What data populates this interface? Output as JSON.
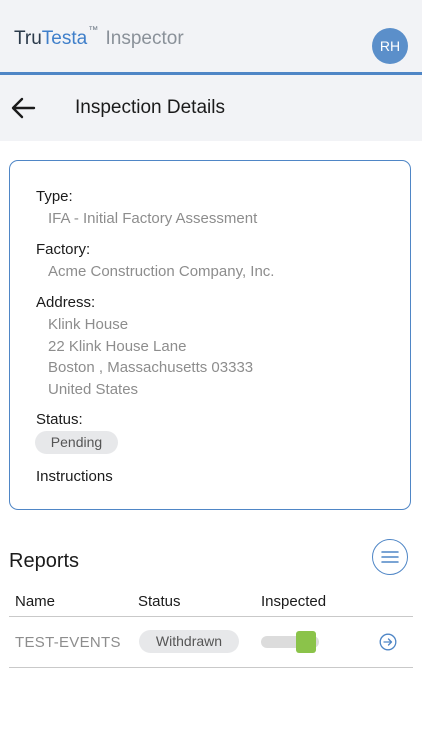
{
  "header": {
    "brand_tru": "Tru",
    "brand_testa": "Testa",
    "brand_tm": "™",
    "brand_inspector": "Inspector",
    "avatar_initials": "RH"
  },
  "subheader": {
    "back_icon": "arrow-left-icon",
    "title": "Inspection Details"
  },
  "details": {
    "type_label": "Type:",
    "type_value": "IFA - Initial Factory Assessment",
    "factory_label": "Factory:",
    "factory_value": "Acme Construction Company, Inc.",
    "address_label": "Address:",
    "address_lines": [
      "Klink House",
      "22 Klink House Lane",
      "Boston , Massachusetts 03333",
      "United States"
    ],
    "status_label": "Status:",
    "status_value": "Pending",
    "instructions_label": "Instructions"
  },
  "reports": {
    "title": "Reports",
    "menu_icon": "menu-lines-icon",
    "columns": [
      "Name",
      "Status",
      "Inspected"
    ],
    "rows": [
      {
        "name": "TEST-EVENTS",
        "status": "Withdrawn",
        "inspected": true,
        "action_icon": "arrow-circle-right-icon"
      }
    ]
  },
  "colors": {
    "accent": "#4f86c6",
    "header_bg": "#f2f3f6",
    "toggle_on": "#8bc34a",
    "muted_text": "#8d8d8d"
  }
}
